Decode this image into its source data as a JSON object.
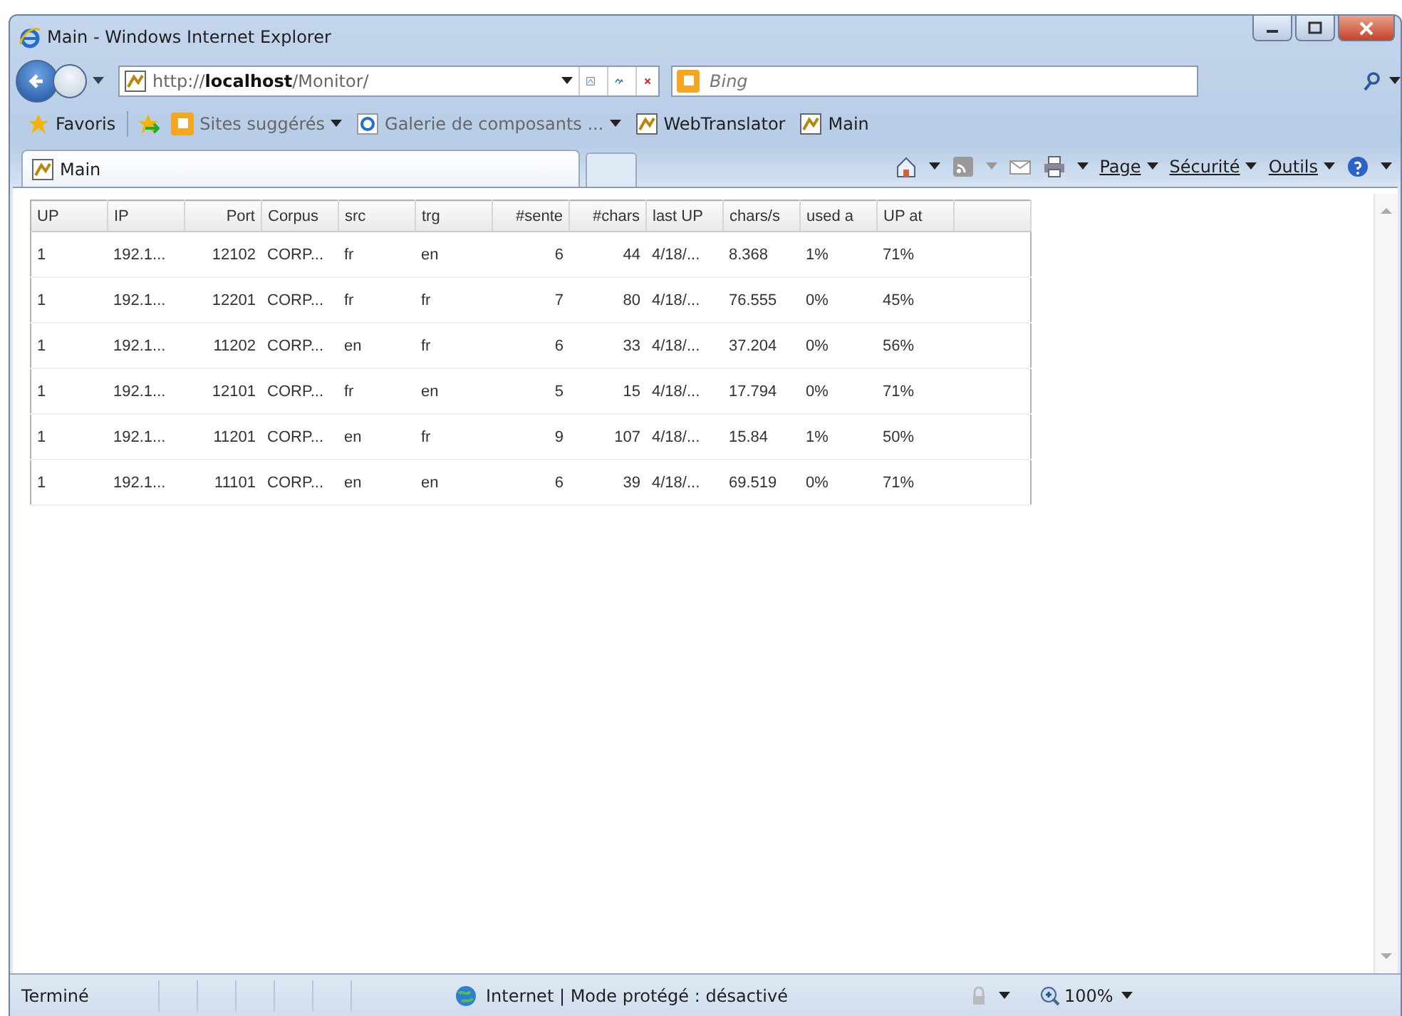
{
  "window": {
    "title": "Main - Windows Internet Explorer"
  },
  "address_bar": {
    "url_prefix": "http://",
    "url_host": "localhost",
    "url_path": "/Monitor/"
  },
  "search": {
    "placeholder": "Bing"
  },
  "favorites_bar": {
    "favorites": "Favoris",
    "items": [
      {
        "label": "Sites suggérés",
        "kind": "dropdown"
      },
      {
        "label": "Galerie de composants ...",
        "kind": "dropdown"
      },
      {
        "label": "WebTranslator",
        "kind": "link"
      },
      {
        "label": "Main",
        "kind": "link"
      }
    ]
  },
  "tab": {
    "label": "Main",
    "selected": true
  },
  "command_bar": [
    "Page",
    "Sécurité",
    "Outils"
  ],
  "table": {
    "columns": [
      {
        "label": "UP",
        "kind": "text"
      },
      {
        "label": "IP",
        "kind": "text"
      },
      {
        "label": "Port",
        "kind": "number"
      },
      {
        "label": "Corpus",
        "kind": "text"
      },
      {
        "label": "src",
        "kind": "text"
      },
      {
        "label": "trg",
        "kind": "text"
      },
      {
        "label": "#sente",
        "kind": "number"
      },
      {
        "label": "#chars",
        "kind": "number"
      },
      {
        "label": "last UP",
        "kind": "text"
      },
      {
        "label": "chars/s",
        "kind": "text"
      },
      {
        "label": "used a",
        "kind": "text"
      },
      {
        "label": "UP at",
        "kind": "text"
      }
    ],
    "rows": [
      [
        "1",
        "192.1...",
        "12102",
        "CORP...",
        "fr",
        "en",
        "6",
        "44",
        "4/18/...",
        "8.368",
        "1%",
        "71%"
      ],
      [
        "1",
        "192.1...",
        "12201",
        "CORP...",
        "fr",
        "fr",
        "7",
        "80",
        "4/18/...",
        "76.555",
        "0%",
        "45%"
      ],
      [
        "1",
        "192.1...",
        "11202",
        "CORP...",
        "en",
        "fr",
        "6",
        "33",
        "4/18/...",
        "37.204",
        "0%",
        "56%"
      ],
      [
        "1",
        "192.1...",
        "12101",
        "CORP...",
        "fr",
        "en",
        "5",
        "15",
        "4/18/...",
        "17.794",
        "0%",
        "71%"
      ],
      [
        "1",
        "192.1...",
        "11201",
        "CORP...",
        "en",
        "fr",
        "9",
        "107",
        "4/18/...",
        "15.84",
        "1%",
        "50%"
      ],
      [
        "1",
        "192.1...",
        "11101",
        "CORP...",
        "en",
        "en",
        "6",
        "39",
        "4/18/...",
        "69.519",
        "0%",
        "71%"
      ]
    ]
  },
  "status_bar": {
    "status": "Terminé",
    "zone": "Internet | Mode protégé : désactivé",
    "zoom": "100%"
  }
}
